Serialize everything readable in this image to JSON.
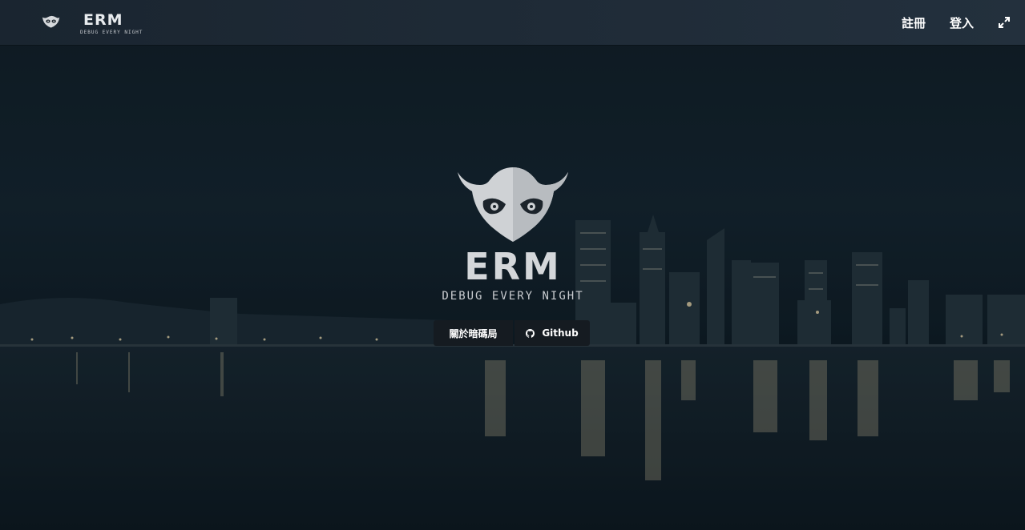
{
  "brand": {
    "name": "ERM",
    "tagline": "DEBUG EVERY NIGHT",
    "logo_icon": "owl-logo-icon"
  },
  "nav": {
    "register_label": "註冊",
    "login_label": "登入",
    "fullscreen_icon": "expand-icon"
  },
  "hero": {
    "title": "ERM",
    "subtitle": "DEBUG EVERY NIGHT",
    "logo_icon": "owl-logo-icon",
    "buttons": {
      "about_label": "關於暗碼局",
      "github_label": "Github",
      "github_icon": "github-icon"
    }
  },
  "colors": {
    "navbar": "#1f2b37",
    "background": "#0c171f",
    "button": "#151b21",
    "text": "#ffffff"
  }
}
